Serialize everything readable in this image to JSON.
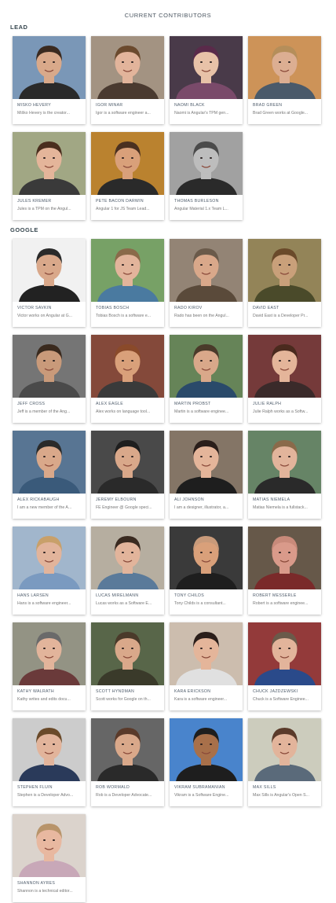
{
  "page": {
    "title": "CURRENT CONTRIBUTORS"
  },
  "groups": [
    {
      "label": "LEAD",
      "contributors": [
        {
          "name": "MIŠKO HEVERY",
          "bio": "Miško Hevery is the creator...",
          "bg": "#6f8fb1",
          "skin": "#d9a98a",
          "hair": "#3a2a20",
          "shirt": "#2a2a2a"
        },
        {
          "name": "IGOR MINAR",
          "bio": "Igor is a software engineer a...",
          "bg": "#9c8a78",
          "skin": "#e2b49b",
          "hair": "#6b4a2e",
          "shirt": "#4a3a30"
        },
        {
          "name": "NAOMI BLACK",
          "bio": "Naomi is Angular's TPM gen...",
          "bg": "#3a2a3a",
          "skin": "#e8c2a8",
          "hair": "#5a2a4a",
          "shirt": "#7a4a6a"
        },
        {
          "name": "BRAD GREEN",
          "bio": "Brad Green works at Google...",
          "bg": "#c98a4a",
          "skin": "#dcae92",
          "hair": "#b58e5a",
          "shirt": "#4a5a6a"
        },
        {
          "name": "JULES KREMER",
          "bio": "Jules is a TPM on the Angul...",
          "bg": "#9aa07a",
          "skin": "#e4b59a",
          "hair": "#4a2e1e",
          "shirt": "#3a3a3a"
        },
        {
          "name": "PETE BACON DARWIN",
          "bio": "Angular 1 for JS Team Lead...",
          "bg": "#b5781e",
          "skin": "#d9a07a",
          "hair": "#4a3020",
          "shirt": "#2a2a2a"
        },
        {
          "name": "THOMAS BURLESON",
          "bio": "Angular Material 1.x Team L...",
          "bg": "#9a9a9a",
          "skin": "#bdbdbd",
          "hair": "#4a4a4a",
          "shirt": "#2a2a2a"
        }
      ]
    },
    {
      "label": "GOOGLE",
      "contributors": [
        {
          "name": "VICTOR SAVKIN",
          "bio": "Victor works on Angular at G...",
          "bg": "#f0f0f0",
          "skin": "#d9a88a",
          "hair": "#2a2a2a",
          "shirt": "#222222"
        },
        {
          "name": "TOBIAS BOSCH",
          "bio": "Tobias Bosch is a software e...",
          "bg": "#6c9a5a",
          "skin": "#e2b49b",
          "hair": "#8a6a4a",
          "shirt": "#4a7aa0"
        },
        {
          "name": "RADO KIROV",
          "bio": "Rado has been on the Angul...",
          "bg": "#8a7a6a",
          "skin": "#d9a88a",
          "hair": "#6a5a4a",
          "shirt": "#5a4a3a"
        },
        {
          "name": "DAVID EAST",
          "bio": "David East is a Developer Pr...",
          "bg": "#8a7a4a",
          "skin": "#c9a07a",
          "hair": "#6a4a2a",
          "shirt": "#4a4a2a"
        },
        {
          "name": "JEFF CROSS",
          "bio": "Jeff is a member of the Ang...",
          "bg": "#6a6a6a",
          "skin": "#c99a7a",
          "hair": "#3a2a1e",
          "shirt": "#4a4a4a"
        },
        {
          "name": "ALEX EAGLE",
          "bio": "Alex works on language tool...",
          "bg": "#7a3a2a",
          "skin": "#d9a07a",
          "hair": "#8a4a2a",
          "shirt": "#3a3a3a"
        },
        {
          "name": "MARTIN PROBST",
          "bio": "Martin is a software enginee...",
          "bg": "#5a7a4a",
          "skin": "#d9a88a",
          "hair": "#4a3a2a",
          "shirt": "#2a4a6a"
        },
        {
          "name": "JULIE RALPH",
          "bio": "Julie Ralph works as a Softw...",
          "bg": "#6a2a2a",
          "skin": "#e4b59a",
          "hair": "#4a2a1e",
          "shirt": "#3a2a2a"
        },
        {
          "name": "ALEX RICKABAUGH",
          "bio": "I am a new member of the A...",
          "bg": "#4a6a8a",
          "skin": "#d9a88a",
          "hair": "#2a2a2a",
          "shirt": "#3a5a7a"
        },
        {
          "name": "JEREMY ELBOURN",
          "bio": "FE Engineer @ Google speci...",
          "bg": "#3a3a3a",
          "skin": "#d9a88a",
          "hair": "#1e1e1e",
          "shirt": "#2a2a2a"
        },
        {
          "name": "ALI JOHNSON",
          "bio": "I am a designer, illustrator, a...",
          "bg": "#7a6a5a",
          "skin": "#e4b59a",
          "hair": "#2a1e1a",
          "shirt": "#1e1e1e"
        },
        {
          "name": "MATIAS NIEMELA",
          "bio": "Matias Niemela is a fullstack...",
          "bg": "#5a7a5a",
          "skin": "#e2b49b",
          "hair": "#8a6a4a",
          "shirt": "#2a2a2a"
        },
        {
          "name": "HANS LARSEN",
          "bio": "Hans is a software engineer...",
          "bg": "#9ab0c8",
          "skin": "#e2b49b",
          "hair": "#c8a06a",
          "shirt": "#7a9ac0"
        },
        {
          "name": "LUCAS MIRELMANN",
          "bio": "Lucas works as a Software E...",
          "bg": "#b0a898",
          "skin": "#e2b49b",
          "hair": "#3a2a20",
          "shirt": "#5a7a9a"
        },
        {
          "name": "TONY CHILDS",
          "bio": "Tony Childs is a consultant...",
          "bg": "#2a2a2a",
          "skin": "#d9a07a",
          "hair": "#c89a7a",
          "shirt": "#1e1e1e"
        },
        {
          "name": "ROBERT MESSERLE",
          "bio": "Robert is a software enginee...",
          "bg": "#5a4a3a",
          "skin": "#d99a8a",
          "hair": "#c88a7a",
          "shirt": "#7a2a2a"
        },
        {
          "name": "KATHY WALRATH",
          "bio": "Kathy writes and edits docu...",
          "bg": "#8a8a7a",
          "skin": "#e2b49b",
          "hair": "#6a6a6a",
          "shirt": "#6a3a3a"
        },
        {
          "name": "SCOTT HYNDMAN",
          "bio": "Scott works for Google on th...",
          "bg": "#4a5a3a",
          "skin": "#d9a88a",
          "hair": "#4a3a2a",
          "shirt": "#3a3a2a"
        },
        {
          "name": "KARA ERICKSON",
          "bio": "Kara is a software engineer...",
          "bg": "#c8b8a8",
          "skin": "#e4b59a",
          "hair": "#2a1e1a",
          "shirt": "#e0e0e0"
        },
        {
          "name": "CHUCK JAZDZEWSKI",
          "bio": "Chuck is a Software Enginee...",
          "bg": "#8a2a2a",
          "skin": "#e2b49b",
          "hair": "#6a5a4a",
          "shirt": "#2a4a8a"
        },
        {
          "name": "STEPHEN FLUIN",
          "bio": "Stephen is a Developer Advo...",
          "bg": "#c8c8c8",
          "skin": "#e2b49b",
          "hair": "#6a4a2a",
          "shirt": "#2a3a5a"
        },
        {
          "name": "ROB WORMALD",
          "bio": "Rob is a Developer Advocate...",
          "bg": "#5a5a5a",
          "skin": "#d9a88a",
          "hair": "#5a3a2a",
          "shirt": "#2a2a2a"
        },
        {
          "name": "VIKRAM SUBRAMANIAN",
          "bio": "Vikram is a Software Engine...",
          "bg": "#3a7ac8",
          "skin": "#a8704a",
          "hair": "#1e1e1e",
          "shirt": "#1e1e1e"
        },
        {
          "name": "MAX SILLS",
          "bio": "Max Sills is Angular's Open S...",
          "bg": "#c8c8b8",
          "skin": "#e2b49b",
          "hair": "#5a3a2a",
          "shirt": "#5a6a7a"
        },
        {
          "name": "SHANNON AYRES",
          "bio": "Shannon is a technical editor...",
          "bg": "#d8d0c8",
          "skin": "#e8b8a0",
          "hair": "#b8946a",
          "shirt": "#c8a8b8"
        }
      ]
    }
  ]
}
